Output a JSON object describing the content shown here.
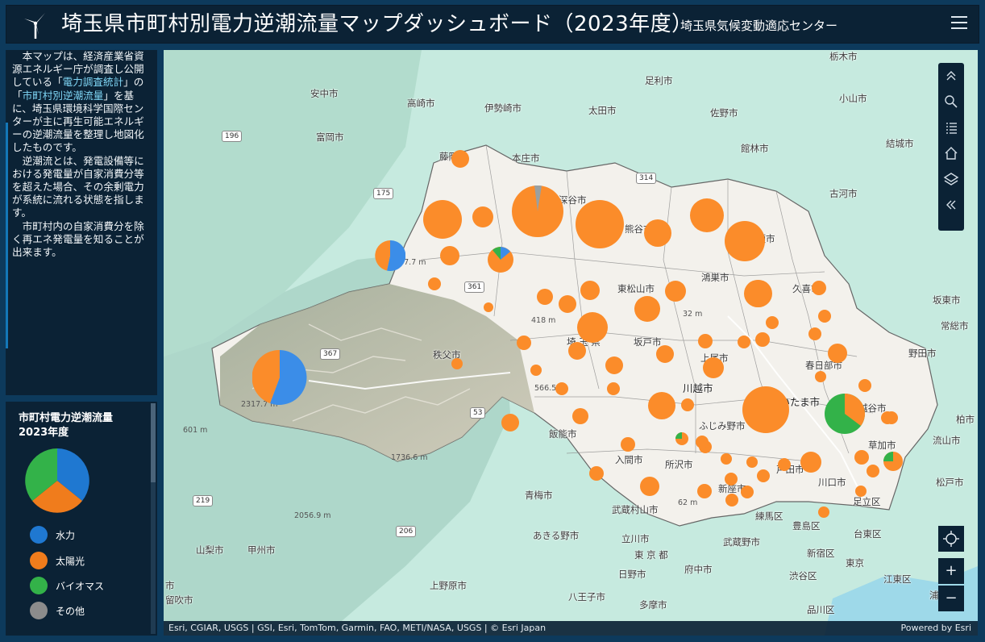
{
  "header": {
    "title": "埼玉県市町村別電力逆潮流量マップダッシュボード（2023年度）",
    "subtitle": "埼玉県気候変動適応センター",
    "menu_icon": "hamburger-menu-icon",
    "logo_icon": "wind-turbine-icon"
  },
  "description": {
    "p1_pre": "本マップは、経済産業省資源エネルギー庁が調査し公開している「",
    "p1_link1": "電力調査統計",
    "p1_mid": "」の「",
    "p1_link2": "市町村別逆潮流量",
    "p1_post": "」を基に、埼玉県環境科学国際センターが主に再生可能エネルギーの逆潮流量を整理し地図化したものです。",
    "p2": "逆潮流とは、発電設備等における発電量が自家消費分等を超えた場合、その余剰電力が系統に流れる状態を指します。",
    "p3": "市町村内の自家消費分を除く再エネ発電量を知ることが出来ます。"
  },
  "legend": {
    "title_line1": "市町村電力逆潮流量",
    "title_line2": "2023年度",
    "items": [
      {
        "label": "水力",
        "color": "#1f78d1"
      },
      {
        "label": "太陽光",
        "color": "#f07c1c"
      },
      {
        "label": "バイオマス",
        "color": "#33b249"
      },
      {
        "label": "その他",
        "color": "#8c8c8c"
      }
    ],
    "summary_shares": {
      "水力": 0.36,
      "太陽光": 0.36,
      "バイオマス": 0.28,
      "その他": 0
    }
  },
  "map": {
    "place_labels": [
      {
        "text": "栃木市"
      },
      {
        "text": "高崎市"
      },
      {
        "text": "伊勢崎市"
      },
      {
        "text": "太田市"
      },
      {
        "text": "足利市"
      },
      {
        "text": "佐野市"
      },
      {
        "text": "小山市"
      },
      {
        "text": "安中市"
      },
      {
        "text": "富岡市"
      },
      {
        "text": "藤岡市"
      },
      {
        "text": "本庄市"
      },
      {
        "text": "館林市"
      },
      {
        "text": "結城市"
      },
      {
        "text": "古河市"
      },
      {
        "text": "深谷市"
      },
      {
        "text": "熊谷市"
      },
      {
        "text": "加須市"
      },
      {
        "text": "鴻巣市"
      },
      {
        "text": "東松山市"
      },
      {
        "text": "久喜市"
      },
      {
        "text": "坂東市"
      },
      {
        "text": "常総市"
      },
      {
        "text": "埼 玉 県"
      },
      {
        "text": "坂戸市"
      },
      {
        "text": "上尾市"
      },
      {
        "text": "秩父市"
      },
      {
        "text": "野田市"
      },
      {
        "text": "春日部市"
      },
      {
        "text": "川越市"
      },
      {
        "text": "さいたま市"
      },
      {
        "text": "越谷市"
      },
      {
        "text": "柏市"
      },
      {
        "text": "ふじみ野市"
      },
      {
        "text": "飯能市"
      },
      {
        "text": "草加市"
      },
      {
        "text": "流山市"
      },
      {
        "text": "入間市"
      },
      {
        "text": "所沢市"
      },
      {
        "text": "戸田市"
      },
      {
        "text": "川口市"
      },
      {
        "text": "松戸市"
      },
      {
        "text": "新座市"
      },
      {
        "text": "足立区"
      },
      {
        "text": "青梅市"
      },
      {
        "text": "武蔵村山市"
      },
      {
        "text": "練馬区"
      },
      {
        "text": "豊島区"
      },
      {
        "text": "あきる野市"
      },
      {
        "text": "立川市"
      },
      {
        "text": "台東区"
      },
      {
        "text": "東 京 都"
      },
      {
        "text": "武蔵野市"
      },
      {
        "text": "新宿区"
      },
      {
        "text": "山梨市"
      },
      {
        "text": "甲州市"
      },
      {
        "text": "府中市"
      },
      {
        "text": "東京"
      },
      {
        "text": "日野市"
      },
      {
        "text": "渋谷区"
      },
      {
        "text": "江東区"
      },
      {
        "text": "上野原市"
      },
      {
        "text": "八王子市"
      },
      {
        "text": "多摩市"
      },
      {
        "text": "品川区"
      },
      {
        "text": "浦安"
      },
      {
        "text": "留吹市"
      },
      {
        "text": "市"
      }
    ],
    "road_shields": [
      "196",
      "175",
      "314",
      "361",
      "367",
      "53",
      "219",
      "206"
    ],
    "elevations": [
      "2317.7 m",
      "1037.7 m",
      "418 m",
      "566.5 m",
      "1736.6 m",
      "2056.9 m",
      "62 m",
      "32 m",
      "601 m"
    ],
    "toolbar_icons": [
      "collapse-up-icon",
      "search-icon",
      "list-icon",
      "home-icon",
      "layers-icon",
      "collapse-left-icon"
    ],
    "locate_icon": "locate-icon",
    "zoom_in": "+",
    "zoom_out": "−",
    "attribution": "Esri, CGIAR, USGS | GSI, Esri, TomTom, Garmin, FAO, METI/NASA, USGS | © Esri Japan",
    "powered_by": "Powered by Esri"
  }
}
